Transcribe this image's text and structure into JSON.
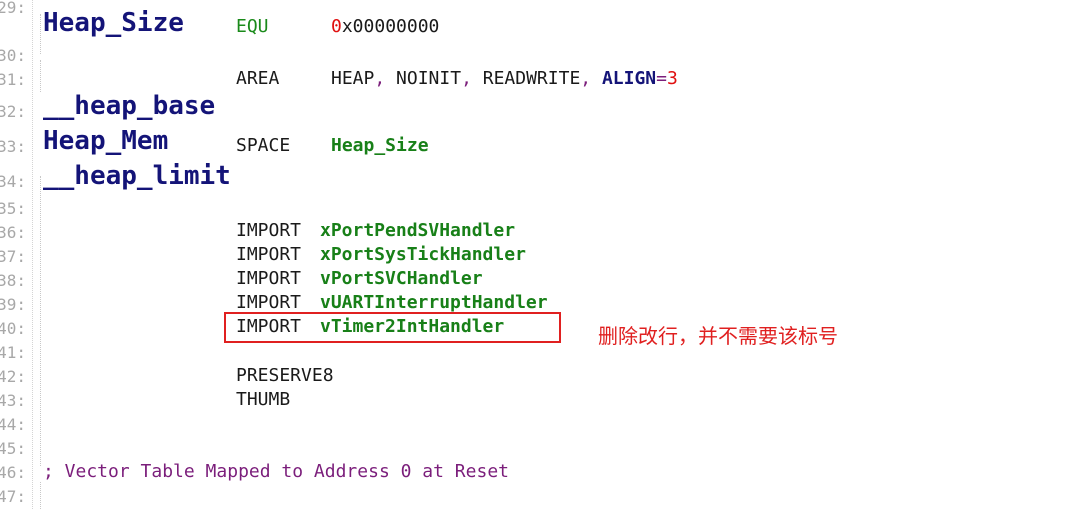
{
  "line_numbers": [
    "29:",
    "30:",
    "31:",
    "32:",
    "33:",
    "34:",
    "35:",
    "36:",
    "37:",
    "38:",
    "39:",
    "40:",
    "41:",
    "42:",
    "43:",
    "44:",
    "45:",
    "46:",
    "47:"
  ],
  "code": {
    "heap_size_label": "Heap_Size",
    "equ_keyword": "EQU",
    "equ_value_prefix": "0",
    "equ_value_rest": "x00000000",
    "area_keyword": "AREA",
    "area_name": "HEAP",
    "comma1": ",",
    "noinit": " NOINIT",
    "comma2": ",",
    "readwrite": " READWRITE",
    "comma3": ",",
    "align_keyword": " ALIGN",
    "align_eq": "=",
    "align_value": "3",
    "heap_base_label": "__heap_base",
    "heap_mem_label": "Heap_Mem",
    "space_keyword": "SPACE",
    "space_arg": "Heap_Size",
    "heap_limit_label": "__heap_limit",
    "imports": [
      {
        "keyword": "IMPORT",
        "symbol": "xPortPendSVHandler"
      },
      {
        "keyword": "IMPORT",
        "symbol": "xPortSysTickHandler"
      },
      {
        "keyword": "IMPORT",
        "symbol": "vPortSVCHandler"
      },
      {
        "keyword": "IMPORT",
        "symbol": "vUARTInterruptHandler"
      },
      {
        "keyword": "IMPORT",
        "symbol": "vTimer2IntHandler"
      }
    ],
    "preserve": "PRESERVE8",
    "thumb": "THUMB",
    "comment": "; Vector Table Mapped to Address 0 at Reset"
  },
  "annotation": {
    "text": "删除改行，并不需要该标号",
    "color": "#e02020"
  },
  "colors": {
    "label": "#141478",
    "keyword_green": "#1a8a1a",
    "symbol_green": "#188018",
    "punct_purple": "#7b1e7b",
    "number_red": "#e01010"
  }
}
